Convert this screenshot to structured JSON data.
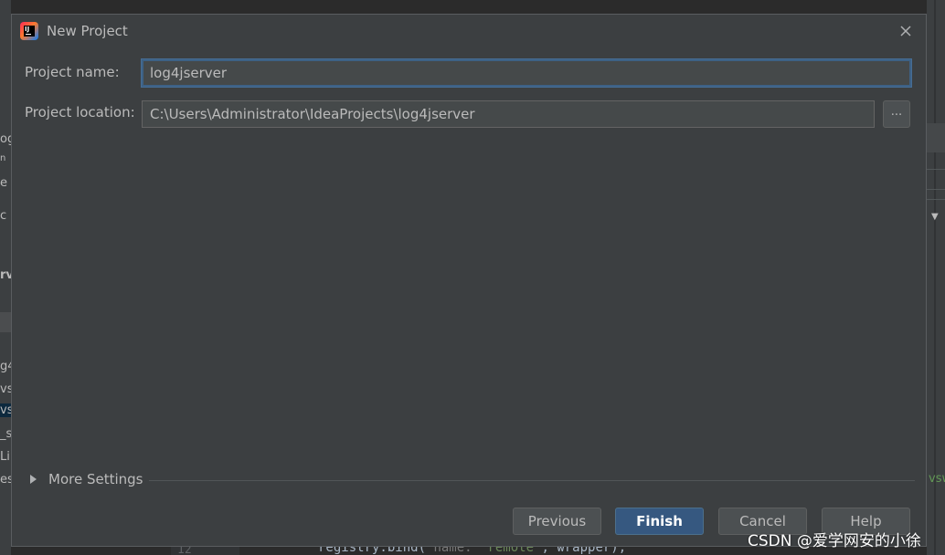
{
  "dialog": {
    "title": "New Project",
    "project_name_label": "Project name:",
    "project_name_value": "log4jserver",
    "project_location_label": "Project location:",
    "project_location_value": "C:\\Users\\Administrator\\IdeaProjects\\log4jserver",
    "browse_label": "...",
    "more_settings_label": "More Settings",
    "buttons": {
      "previous": "Previous",
      "finish": "Finish",
      "cancel": "Cancel",
      "help": "Help"
    }
  },
  "background_ide": {
    "left_fragments": [
      "og",
      "n",
      "e",
      "c",
      "rv",
      "g4",
      "vs",
      "vs",
      "_s",
      "Li",
      "es"
    ],
    "line_number": "12",
    "code_prefix": "registry.bind(",
    "code_hint": " name:",
    "code_string": " \"remote\"",
    "code_suffix": ", wrapper);",
    "right_fragment": "vsw"
  },
  "watermark": "CSDN @爱学网安的小徐",
  "colors": {
    "dialog_bg": "#3c3f41",
    "field_bg": "#45494a",
    "focus_border": "#3d6185",
    "primary_button": "#365880",
    "text": "#bbbbbb"
  },
  "icons": {
    "app": "intellij-idea-icon",
    "close": "close-icon",
    "expand": "triangle-right-icon"
  }
}
